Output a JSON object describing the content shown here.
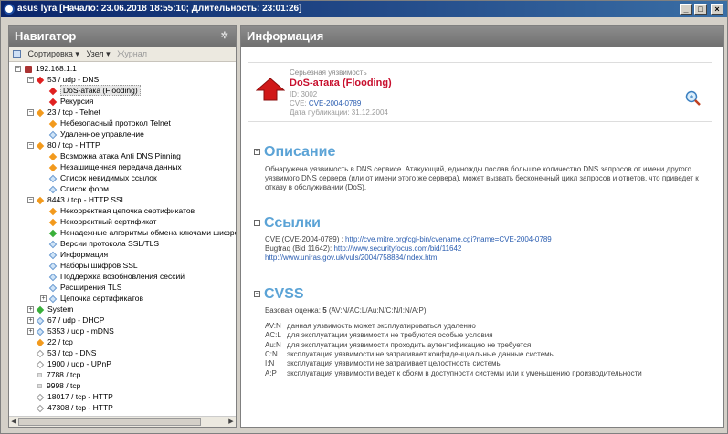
{
  "window": {
    "title": "asus lyra [Начало: 23.06.2018 18:55:10; Длительность: 23:01:26]",
    "minimize_label": "_",
    "maximize_label": "□",
    "close_label": "×"
  },
  "navigator": {
    "title": "Навигатор",
    "toolbar": {
      "sort_label": "Сортировка ▾",
      "node_label": "Узел ▾",
      "journal_label": "Журнал"
    },
    "tree": [
      {
        "label": "192.168.1.1",
        "level": 0,
        "icon": "host-icon",
        "exp": "−"
      },
      {
        "label": "53 / udp - DNS",
        "level": 1,
        "icon": "red",
        "exp": "−"
      },
      {
        "label": "DoS-атака (Flooding)",
        "level": 2,
        "icon": "red",
        "selected": true
      },
      {
        "label": "Рекурсия",
        "level": 2,
        "icon": "red"
      },
      {
        "label": "23 / tcp - Telnet",
        "level": 1,
        "icon": "org",
        "exp": "−"
      },
      {
        "label": "Небезопасный протокол Telnet",
        "level": 2,
        "icon": "org"
      },
      {
        "label": "Удаленное управление",
        "level": 2,
        "icon": "blu"
      },
      {
        "label": "80 / tcp - HTTP",
        "level": 1,
        "icon": "org",
        "exp": "−"
      },
      {
        "label": "Возможна атака Anti DNS Pinning",
        "level": 2,
        "icon": "org"
      },
      {
        "label": "Незашищенная передача данных",
        "level": 2,
        "icon": "org"
      },
      {
        "label": "Список невидимых ссылок",
        "level": 2,
        "icon": "blu"
      },
      {
        "label": "Список форм",
        "level": 2,
        "icon": "blu"
      },
      {
        "label": "8443 / tcp - HTTP SSL",
        "level": 1,
        "icon": "org",
        "exp": "−"
      },
      {
        "label": "Некорректная цепочка сертификатов",
        "level": 2,
        "icon": "org"
      },
      {
        "label": "Некорректный сертификат",
        "level": 2,
        "icon": "org"
      },
      {
        "label": "Ненадежные алгоритмы обмена ключами шифро",
        "level": 2,
        "icon": "grn"
      },
      {
        "label": "Версии протокола SSL/TLS",
        "level": 2,
        "icon": "blu"
      },
      {
        "label": "Информация",
        "level": 2,
        "icon": "blu"
      },
      {
        "label": "Наборы шифров SSL",
        "level": 2,
        "icon": "blu"
      },
      {
        "label": "Поддержка возобновления сессий",
        "level": 2,
        "icon": "blu"
      },
      {
        "label": "Расширения TLS",
        "level": 2,
        "icon": "blu"
      },
      {
        "label": "Цепочка сертификатов",
        "level": 2,
        "icon": "blu",
        "exp": "+"
      },
      {
        "label": "System",
        "level": 1,
        "icon": "grn",
        "exp": "+"
      },
      {
        "label": "67 / udp - DHCP",
        "level": 1,
        "icon": "blu",
        "exp": "+"
      },
      {
        "label": "5353 / udp - mDNS",
        "level": 1,
        "icon": "blu",
        "exp": "+"
      },
      {
        "label": "22 / tcp",
        "level": 1,
        "icon": "org"
      },
      {
        "label": "53 / tcp - DNS",
        "level": 1,
        "icon": "wht"
      },
      {
        "label": "1900 / udp - UPnP",
        "level": 1,
        "icon": "wht"
      },
      {
        "label": "7788 / tcp",
        "level": 1,
        "icon": "sq"
      },
      {
        "label": "9998 / tcp",
        "level": 1,
        "icon": "sq"
      },
      {
        "label": "18017 / tcp - HTTP",
        "level": 1,
        "icon": "wht"
      },
      {
        "label": "47308 / tcp - HTTP",
        "level": 1,
        "icon": "wht"
      }
    ]
  },
  "info": {
    "title": "Информация",
    "severity": "Серьезная уязвимость",
    "vuln_title": "DoS-атака (Flooding)",
    "id_line": "ID: 3002",
    "cve_prefix": "CVE: ",
    "cve": "CVE-2004-0789",
    "date_line": "Дата публикации: 31.12.2004",
    "description_heading": "Описание",
    "description": "Обнаружена уязвимость в DNS сервисе. Атакующий, единожды послав большое количество DNS запросов от имени другого уязвимого DNS сервера (или от имени этого же сервера), может вызвать бесконечный цикл запросов и ответов, что приведет к отказу в обслуживании (DoS).",
    "links_heading": "Ссылки",
    "link1_prefix": "CVE (CVE-2004-0789) : ",
    "link1": "http://cve.mitre.org/cgi-bin/cvename.cgi?name=CVE-2004-0789",
    "link2_prefix": "Bugtraq (Bid 11642): ",
    "link2": "http://www.securityfocus.com/bid/11642",
    "link3": "http://www.uniras.gov.uk/vuls/2004/758884/index.htm",
    "cvss_heading": "CVSS",
    "base_prefix": "Базовая оценка: ",
    "base_score": "5",
    "base_vector": " (AV:N/AC:L/Au:N/C:N/I:N/A:P)",
    "metrics": [
      {
        "k": "AV:N",
        "v": "данная уязвимость может эксплуатироваться удаленно"
      },
      {
        "k": "AC:L",
        "v": "для эксплуатации уязвимости не требуются особые условия"
      },
      {
        "k": "Au:N",
        "v": "для эксплуатации уязвимости проходить аутентификацию не требуется"
      },
      {
        "k": "C:N",
        "v": "эксплуатация уязвимости не затрагивает конфиденциальные данные системы"
      },
      {
        "k": "I:N",
        "v": "эксплуатация уязвимости не затрагивает целостность системы"
      },
      {
        "k": "A:P",
        "v": "эксплуатация уязвимости ведет к сбоям в доступности системы или к уменьшению производительности"
      }
    ]
  }
}
